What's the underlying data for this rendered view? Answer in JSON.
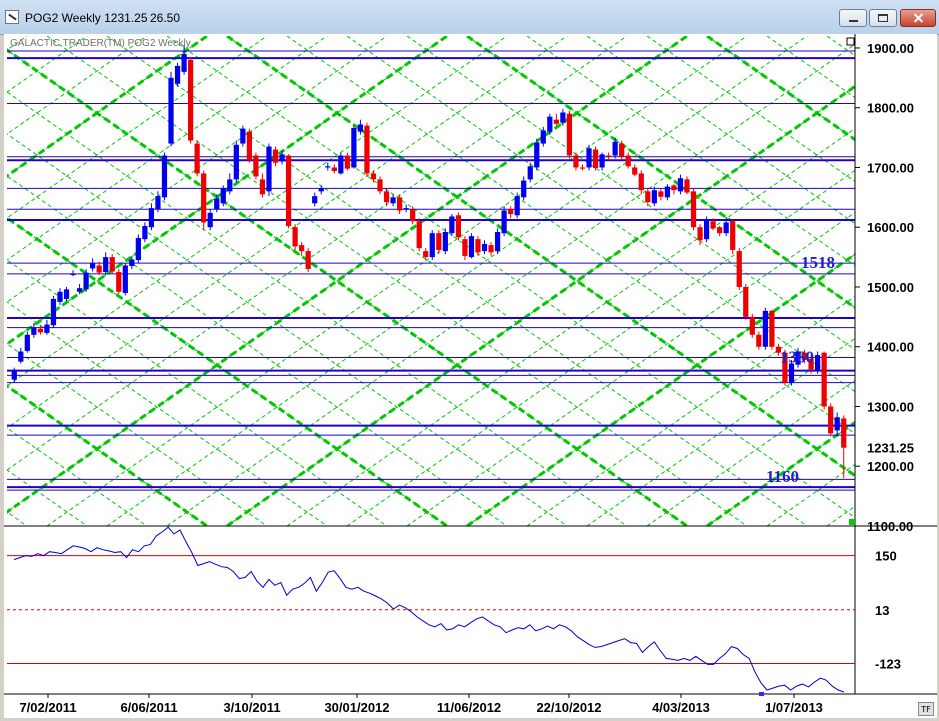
{
  "window": {
    "title": "POG2 Weekly 1231.25",
    "change": "26.50",
    "icon": "chart-icon",
    "buttons": [
      "minimize-icon",
      "restore-icon",
      "close-icon"
    ]
  },
  "chart_data": [
    {
      "type": "candlestick",
      "panel": "price",
      "title": "GALACTIC TRADER(TM)   POG2 Weekly",
      "x": [
        "7/02/2011",
        "6/06/2011",
        "3/10/2011",
        "30/01/2012",
        "11/06/2012",
        "22/10/2012",
        "4/03/2013",
        "1/07/2013"
      ],
      "ylim": [
        1100,
        1920
      ],
      "yticks": [
        "1900.00",
        "1800.00",
        "1700.00",
        "1600.00",
        "1500.00",
        "1400.00",
        "1300.00",
        "1200.00",
        "1100.00"
      ],
      "last_value": "1231.25",
      "up_color": "#0000ee",
      "down_color": "#ee0000",
      "annotations": [
        "1518",
        "1360",
        "1160"
      ],
      "horizontal_levels": [
        1895,
        1883,
        1807,
        1718,
        1712,
        1665,
        1630,
        1612,
        1540,
        1522,
        1448,
        1432,
        1382,
        1360,
        1352,
        1340,
        1268,
        1252,
        1178,
        1165,
        1160
      ],
      "grid_color": "#00c800",
      "level_color": "#2200cc",
      "series": [
        {
          "name": "",
          "open": [
            1345,
            1375,
            1393,
            1420,
            1430,
            1423,
            1436,
            1475,
            1480,
            1520,
            1492,
            1496,
            1531,
            1536,
            1525,
            1550,
            1525,
            1490,
            1535,
            1545,
            1580,
            1600,
            1630,
            1650,
            1740,
            1840,
            1860,
            1880,
            1740,
            1690,
            1600,
            1630,
            1640,
            1660,
            1680,
            1740,
            1760,
            1720,
            1680,
            1660,
            1730,
            1710,
            1720,
            1600,
            1570,
            1560,
            1640,
            1660,
            1700,
            1700,
            1690,
            1720,
            1700,
            1760,
            1770,
            1690,
            1680,
            1660,
            1640,
            1650,
            1630,
            1630,
            1610,
            1560,
            1550,
            1590,
            1560,
            1590,
            1620,
            1580,
            1550,
            1580,
            1560,
            1570,
            1560,
            1590,
            1630,
            1620,
            1650,
            1680,
            1700,
            1740,
            1760,
            1780,
            1775,
            1790,
            1720,
            1700,
            1700,
            1730,
            1700,
            1720,
            1720,
            1740,
            1720,
            1700,
            1690,
            1660,
            1640,
            1660,
            1650,
            1670,
            1660,
            1680,
            1660,
            1600,
            1580,
            1610,
            1600,
            1590,
            1610,
            1560,
            1500,
            1450,
            1420,
            1400,
            1460,
            1400,
            1390,
            1340,
            1370,
            1390,
            1380,
            1360,
            1390,
            1300,
            1260,
            1280
          ],
          "close": [
            1360,
            1392,
            1420,
            1432,
            1424,
            1437,
            1480,
            1492,
            1496,
            1522,
            1498,
            1524,
            1540,
            1524,
            1550,
            1526,
            1492,
            1536,
            1546,
            1582,
            1602,
            1632,
            1652,
            1720,
            1850,
            1870,
            1890,
            1745,
            1690,
            1608,
            1624,
            1648,
            1665,
            1680,
            1738,
            1765,
            1712,
            1685,
            1655,
            1735,
            1708,
            1722,
            1602,
            1568,
            1560,
            1530,
            1652,
            1665,
            1702,
            1694,
            1720,
            1698,
            1766,
            1772,
            1690,
            1680,
            1660,
            1642,
            1650,
            1628,
            1632,
            1610,
            1565,
            1550,
            1590,
            1562,
            1592,
            1618,
            1583,
            1552,
            1585,
            1558,
            1572,
            1558,
            1592,
            1628,
            1622,
            1652,
            1678,
            1702,
            1742,
            1762,
            1785,
            1773,
            1792,
            1720,
            1700,
            1698,
            1732,
            1699,
            1722,
            1718,
            1743,
            1718,
            1702,
            1688,
            1662,
            1642,
            1662,
            1651,
            1668,
            1662,
            1682,
            1658,
            1600,
            1578,
            1612,
            1598,
            1590,
            1608,
            1562,
            1500,
            1450,
            1420,
            1400,
            1460,
            1400,
            1390,
            1340,
            1372,
            1392,
            1378,
            1362,
            1386,
            1300,
            1255,
            1282,
            1231
          ],
          "high": [
            1365,
            1398,
            1425,
            1440,
            1436,
            1445,
            1485,
            1498,
            1500,
            1528,
            1505,
            1530,
            1548,
            1542,
            1558,
            1555,
            1530,
            1540,
            1550,
            1588,
            1608,
            1640,
            1660,
            1725,
            1860,
            1875,
            1905,
            1885,
            1745,
            1695,
            1630,
            1655,
            1670,
            1690,
            1745,
            1770,
            1765,
            1725,
            1690,
            1740,
            1735,
            1728,
            1722,
            1605,
            1575,
            1565,
            1658,
            1670,
            1708,
            1705,
            1725,
            1725,
            1770,
            1780,
            1775,
            1695,
            1685,
            1665,
            1655,
            1655,
            1638,
            1635,
            1615,
            1565,
            1595,
            1595,
            1598,
            1622,
            1625,
            1585,
            1590,
            1585,
            1578,
            1575,
            1598,
            1635,
            1635,
            1658,
            1685,
            1708,
            1748,
            1768,
            1790,
            1790,
            1798,
            1795,
            1725,
            1705,
            1738,
            1735,
            1725,
            1725,
            1750,
            1745,
            1725,
            1705,
            1695,
            1665,
            1668,
            1665,
            1672,
            1672,
            1688,
            1685,
            1665,
            1605,
            1618,
            1615,
            1602,
            1615,
            1612,
            1565,
            1505,
            1455,
            1425,
            1465,
            1462,
            1405,
            1395,
            1378,
            1398,
            1395,
            1385,
            1392,
            1392,
            1305,
            1290,
            1285
          ],
          "low": [
            1340,
            1372,
            1390,
            1415,
            1420,
            1420,
            1432,
            1470,
            1476,
            1518,
            1488,
            1492,
            1526,
            1520,
            1520,
            1522,
            1488,
            1486,
            1530,
            1540,
            1575,
            1595,
            1625,
            1645,
            1735,
            1835,
            1855,
            1740,
            1685,
            1595,
            1595,
            1625,
            1635,
            1655,
            1675,
            1735,
            1708,
            1680,
            1650,
            1652,
            1702,
            1705,
            1598,
            1562,
            1552,
            1525,
            1635,
            1655,
            1695,
            1690,
            1688,
            1695,
            1698,
            1755,
            1685,
            1675,
            1655,
            1635,
            1635,
            1622,
            1625,
            1605,
            1560,
            1545,
            1545,
            1555,
            1555,
            1585,
            1578,
            1545,
            1548,
            1552,
            1555,
            1552,
            1555,
            1585,
            1615,
            1615,
            1645,
            1675,
            1695,
            1735,
            1755,
            1770,
            1770,
            1715,
            1695,
            1695,
            1695,
            1695,
            1695,
            1712,
            1715,
            1712,
            1698,
            1685,
            1655,
            1635,
            1635,
            1645,
            1645,
            1655,
            1655,
            1655,
            1595,
            1570,
            1575,
            1595,
            1585,
            1585,
            1555,
            1495,
            1445,
            1415,
            1395,
            1395,
            1395,
            1385,
            1335,
            1335,
            1365,
            1372,
            1355,
            1355,
            1295,
            1250,
            1250,
            1180
          ]
        }
      ]
    },
    {
      "type": "line",
      "panel": "oscillator",
      "yticks": [
        "150",
        "13",
        "-123"
      ],
      "ylim": [
        -200,
        225
      ],
      "reference_lines": [
        {
          "value": 150,
          "style": "solid",
          "color": "#dd0000"
        },
        {
          "value": 13,
          "style": "dashed",
          "color": "#dd0000"
        },
        {
          "value": -123,
          "style": "solid",
          "color": "#dd0000"
        }
      ],
      "line_color": "#0000cc",
      "series": [
        {
          "name": "",
          "values": [
            140,
            145,
            150,
            148,
            155,
            150,
            160,
            158,
            155,
            165,
            175,
            172,
            168,
            160,
            170,
            165,
            162,
            158,
            160,
            145,
            165,
            160,
            175,
            178,
            200,
            210,
            222,
            205,
            215,
            185,
            158,
            125,
            130,
            135,
            128,
            122,
            120,
            110,
            92,
            95,
            110,
            85,
            70,
            90,
            75,
            82,
            50,
            65,
            70,
            80,
            95,
            60,
            82,
            108,
            112,
            92,
            70,
            65,
            70,
            60,
            55,
            48,
            40,
            30,
            15,
            25,
            18,
            8,
            -5,
            -15,
            -25,
            -30,
            -22,
            -38,
            -35,
            -25,
            -30,
            -20,
            -10,
            -5,
            -15,
            -25,
            -30,
            -45,
            -38,
            -32,
            -35,
            -25,
            -40,
            -35,
            -28,
            -35,
            -25,
            -30,
            -40,
            -55,
            -65,
            -75,
            -82,
            -80,
            -75,
            -70,
            -65,
            -60,
            -70,
            -72,
            -95,
            -80,
            -68,
            -90,
            -110,
            -112,
            -115,
            -110,
            -115,
            -105,
            -115,
            -125,
            -125,
            -110,
            -98,
            -80,
            -85,
            -100,
            -110,
            -145,
            -172,
            -190,
            -185,
            -180,
            -178,
            -190,
            -180,
            -175,
            -182,
            -170,
            -160,
            -165,
            -180,
            -190,
            -195
          ]
        }
      ]
    }
  ],
  "footer": {
    "tf_label": "TF"
  }
}
